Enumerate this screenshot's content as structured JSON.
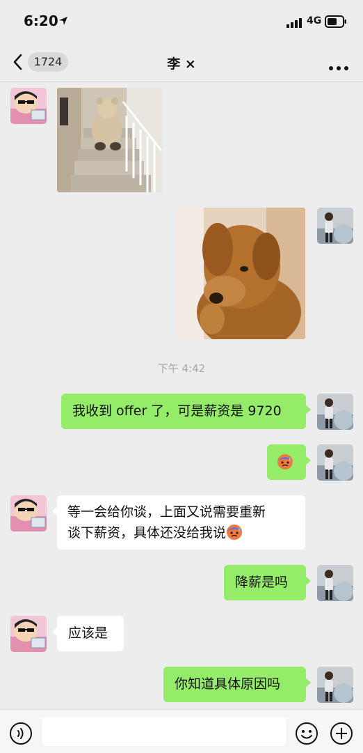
{
  "status_bar": {
    "time": "6:20",
    "network": "4G"
  },
  "nav": {
    "unread_count": "1724",
    "title": "李 ×"
  },
  "chat": {
    "timestamp": "下午 4:42",
    "messages": [
      {
        "side": "left",
        "type": "image",
        "image": "teddy-bear-on-stairs-photo"
      },
      {
        "side": "right",
        "type": "image",
        "image": "sad-dog-photo"
      },
      {
        "side": "right",
        "type": "text",
        "text": "我收到 offer 了，可是薪资是 9720"
      },
      {
        "side": "right",
        "type": "emoji",
        "image": "cold-sweat-emoji"
      },
      {
        "side": "left",
        "type": "text",
        "line1": "等一会给你谈，上面又说需要重新",
        "line2": "谈下薪资，具体还没给我说",
        "emoji": "cold-sweat-emoji"
      },
      {
        "side": "right",
        "type": "text",
        "text": "降薪是吗"
      },
      {
        "side": "left",
        "type": "text",
        "text": "应该是"
      },
      {
        "side": "right",
        "type": "text",
        "text": "你知道具体原因吗"
      }
    ]
  },
  "input_bar": {
    "placeholder": ""
  },
  "colors": {
    "background": "#ededed",
    "bubble_right": "#95ec69",
    "bubble_left": "#ffffff"
  }
}
